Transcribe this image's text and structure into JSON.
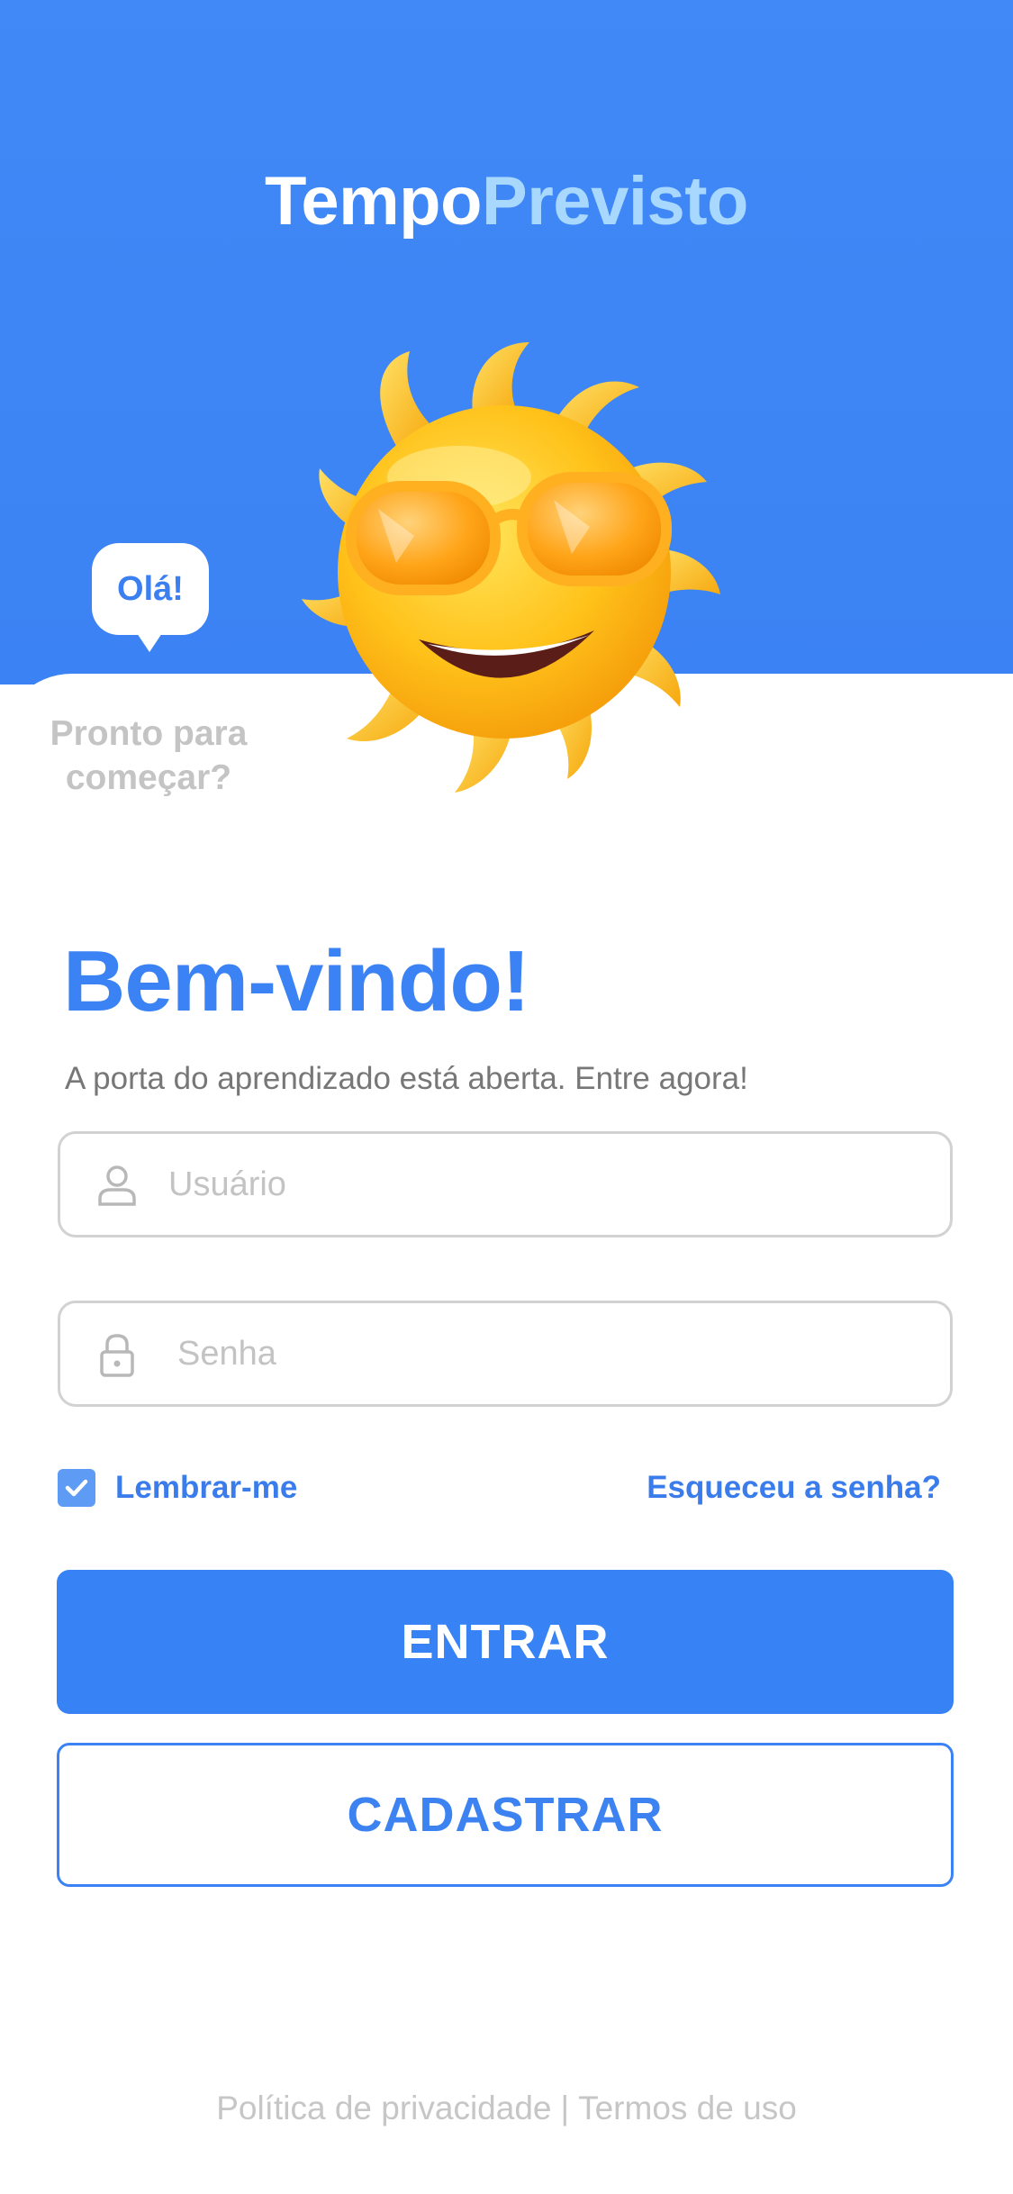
{
  "brand": {
    "part1": "Tempo",
    "part2": "Previsto",
    "color1": "#ffffff",
    "color2": "#a9d8ff"
  },
  "mascot": {
    "bubble_text": "Olá!",
    "caption": "Pronto para começar?",
    "image": "sun-with-sunglasses"
  },
  "login": {
    "title": "Bem-vindo!",
    "subtitle": "A porta do aprendizado está aberta. Entre agora!",
    "username": {
      "placeholder": "Usuário",
      "value": "",
      "icon": "user-icon"
    },
    "password": {
      "placeholder": "Senha",
      "value": "",
      "icon": "lock-icon"
    },
    "remember_label": "Lembrar-me",
    "remember_checked": true,
    "forgot_label": "Esqueceu a senha?",
    "submit_label": "ENTRAR",
    "register_label": "CADASTRAR"
  },
  "footer": {
    "privacy": "Política de privacidade",
    "separator": "|",
    "terms": "Termos de uso"
  },
  "colors": {
    "accent": "#3b82f4",
    "header_bg": "#3b82f4",
    "muted": "#c4c4c4"
  }
}
